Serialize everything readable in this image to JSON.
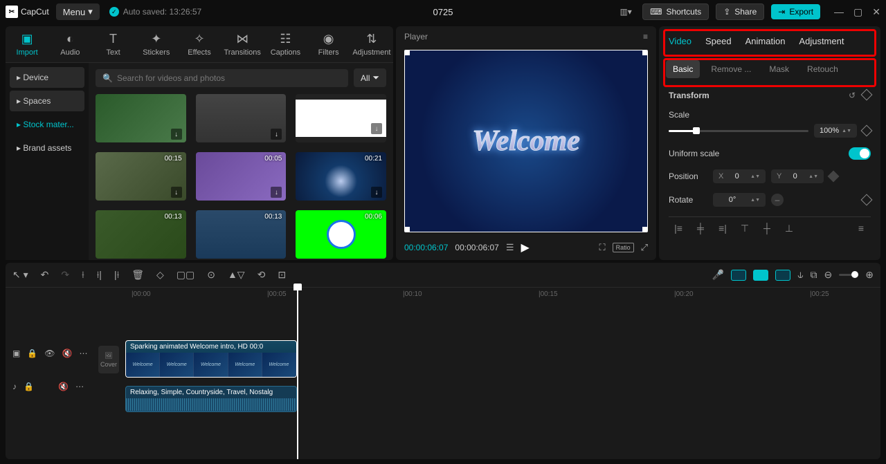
{
  "titlebar": {
    "logo": "CapCut",
    "menu": "Menu",
    "autosave": "Auto saved: 13:26:57",
    "project": "0725",
    "shortcuts": "Shortcuts",
    "share": "Share",
    "export": "Export"
  },
  "tabs": {
    "import": "Import",
    "audio": "Audio",
    "text": "Text",
    "stickers": "Stickers",
    "effects": "Effects",
    "transitions": "Transitions",
    "captions": "Captions",
    "filters": "Filters",
    "adjustment": "Adjustment"
  },
  "sidebar": {
    "device": "Device",
    "spaces": "Spaces",
    "stock": "Stock mater...",
    "brand": "Brand assets"
  },
  "media": {
    "search_placeholder": "Search for videos and photos",
    "all": "All",
    "durs": {
      "d4": "00:15",
      "d5": "00:05",
      "d6": "00:21",
      "d7": "00:13",
      "d8": "00:13",
      "d9": "00:06"
    }
  },
  "player": {
    "label": "Player",
    "welcome": "Welcome",
    "time_current": "00:00:06:07",
    "time_total": "00:00:06:07",
    "ratio": "Ratio"
  },
  "props": {
    "tab_video": "Video",
    "tab_speed": "Speed",
    "tab_animation": "Animation",
    "tab_adjustment": "Adjustment",
    "sub_basic": "Basic",
    "sub_remove": "Remove ...",
    "sub_mask": "Mask",
    "sub_retouch": "Retouch",
    "transform": "Transform",
    "scale": "Scale",
    "scale_val": "100%",
    "uniform": "Uniform scale",
    "position": "Position",
    "pos_x_lbl": "X",
    "pos_x": "0",
    "pos_y_lbl": "Y",
    "pos_y": "0",
    "rotate": "Rotate",
    "rotate_val": "0°"
  },
  "timeline": {
    "marks": {
      "m0": "|00:00",
      "m1": "|00:05",
      "m2": "|00:10",
      "m3": "|00:15",
      "m4": "|00:20",
      "m5": "|00:25"
    },
    "cover": "Cover",
    "clip_video": "Sparking animated Welcome intro, HD   00:0",
    "clip_audio": "Relaxing, Simple, Countryside, Travel, Nostalg",
    "mini": "Welcome"
  }
}
